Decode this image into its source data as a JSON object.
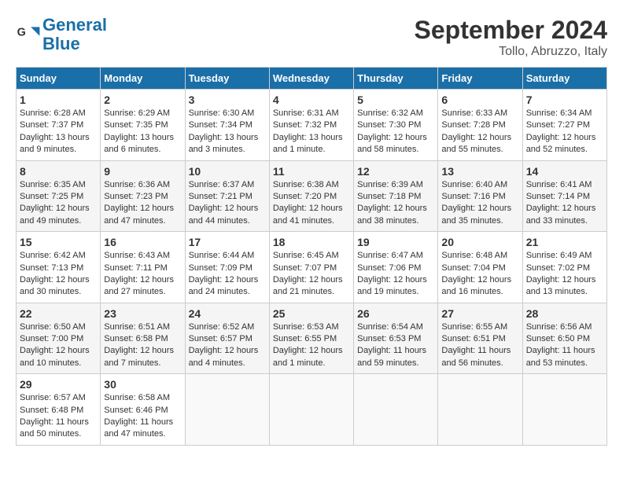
{
  "header": {
    "logo_line1": "General",
    "logo_line2": "Blue",
    "month": "September 2024",
    "location": "Tollo, Abruzzo, Italy"
  },
  "days_of_week": [
    "Sunday",
    "Monday",
    "Tuesday",
    "Wednesday",
    "Thursday",
    "Friday",
    "Saturday"
  ],
  "weeks": [
    [
      {
        "day": "1",
        "info": "Sunrise: 6:28 AM\nSunset: 7:37 PM\nDaylight: 13 hours\nand 9 minutes."
      },
      {
        "day": "2",
        "info": "Sunrise: 6:29 AM\nSunset: 7:35 PM\nDaylight: 13 hours\nand 6 minutes."
      },
      {
        "day": "3",
        "info": "Sunrise: 6:30 AM\nSunset: 7:34 PM\nDaylight: 13 hours\nand 3 minutes."
      },
      {
        "day": "4",
        "info": "Sunrise: 6:31 AM\nSunset: 7:32 PM\nDaylight: 13 hours\nand 1 minute."
      },
      {
        "day": "5",
        "info": "Sunrise: 6:32 AM\nSunset: 7:30 PM\nDaylight: 12 hours\nand 58 minutes."
      },
      {
        "day": "6",
        "info": "Sunrise: 6:33 AM\nSunset: 7:28 PM\nDaylight: 12 hours\nand 55 minutes."
      },
      {
        "day": "7",
        "info": "Sunrise: 6:34 AM\nSunset: 7:27 PM\nDaylight: 12 hours\nand 52 minutes."
      }
    ],
    [
      {
        "day": "8",
        "info": "Sunrise: 6:35 AM\nSunset: 7:25 PM\nDaylight: 12 hours\nand 49 minutes."
      },
      {
        "day": "9",
        "info": "Sunrise: 6:36 AM\nSunset: 7:23 PM\nDaylight: 12 hours\nand 47 minutes."
      },
      {
        "day": "10",
        "info": "Sunrise: 6:37 AM\nSunset: 7:21 PM\nDaylight: 12 hours\nand 44 minutes."
      },
      {
        "day": "11",
        "info": "Sunrise: 6:38 AM\nSunset: 7:20 PM\nDaylight: 12 hours\nand 41 minutes."
      },
      {
        "day": "12",
        "info": "Sunrise: 6:39 AM\nSunset: 7:18 PM\nDaylight: 12 hours\nand 38 minutes."
      },
      {
        "day": "13",
        "info": "Sunrise: 6:40 AM\nSunset: 7:16 PM\nDaylight: 12 hours\nand 35 minutes."
      },
      {
        "day": "14",
        "info": "Sunrise: 6:41 AM\nSunset: 7:14 PM\nDaylight: 12 hours\nand 33 minutes."
      }
    ],
    [
      {
        "day": "15",
        "info": "Sunrise: 6:42 AM\nSunset: 7:13 PM\nDaylight: 12 hours\nand 30 minutes."
      },
      {
        "day": "16",
        "info": "Sunrise: 6:43 AM\nSunset: 7:11 PM\nDaylight: 12 hours\nand 27 minutes."
      },
      {
        "day": "17",
        "info": "Sunrise: 6:44 AM\nSunset: 7:09 PM\nDaylight: 12 hours\nand 24 minutes."
      },
      {
        "day": "18",
        "info": "Sunrise: 6:45 AM\nSunset: 7:07 PM\nDaylight: 12 hours\nand 21 minutes."
      },
      {
        "day": "19",
        "info": "Sunrise: 6:47 AM\nSunset: 7:06 PM\nDaylight: 12 hours\nand 19 minutes."
      },
      {
        "day": "20",
        "info": "Sunrise: 6:48 AM\nSunset: 7:04 PM\nDaylight: 12 hours\nand 16 minutes."
      },
      {
        "day": "21",
        "info": "Sunrise: 6:49 AM\nSunset: 7:02 PM\nDaylight: 12 hours\nand 13 minutes."
      }
    ],
    [
      {
        "day": "22",
        "info": "Sunrise: 6:50 AM\nSunset: 7:00 PM\nDaylight: 12 hours\nand 10 minutes."
      },
      {
        "day": "23",
        "info": "Sunrise: 6:51 AM\nSunset: 6:58 PM\nDaylight: 12 hours\nand 7 minutes."
      },
      {
        "day": "24",
        "info": "Sunrise: 6:52 AM\nSunset: 6:57 PM\nDaylight: 12 hours\nand 4 minutes."
      },
      {
        "day": "25",
        "info": "Sunrise: 6:53 AM\nSunset: 6:55 PM\nDaylight: 12 hours\nand 1 minute."
      },
      {
        "day": "26",
        "info": "Sunrise: 6:54 AM\nSunset: 6:53 PM\nDaylight: 11 hours\nand 59 minutes."
      },
      {
        "day": "27",
        "info": "Sunrise: 6:55 AM\nSunset: 6:51 PM\nDaylight: 11 hours\nand 56 minutes."
      },
      {
        "day": "28",
        "info": "Sunrise: 6:56 AM\nSunset: 6:50 PM\nDaylight: 11 hours\nand 53 minutes."
      }
    ],
    [
      {
        "day": "29",
        "info": "Sunrise: 6:57 AM\nSunset: 6:48 PM\nDaylight: 11 hours\nand 50 minutes."
      },
      {
        "day": "30",
        "info": "Sunrise: 6:58 AM\nSunset: 6:46 PM\nDaylight: 11 hours\nand 47 minutes."
      },
      {
        "day": "",
        "info": ""
      },
      {
        "day": "",
        "info": ""
      },
      {
        "day": "",
        "info": ""
      },
      {
        "day": "",
        "info": ""
      },
      {
        "day": "",
        "info": ""
      }
    ]
  ]
}
